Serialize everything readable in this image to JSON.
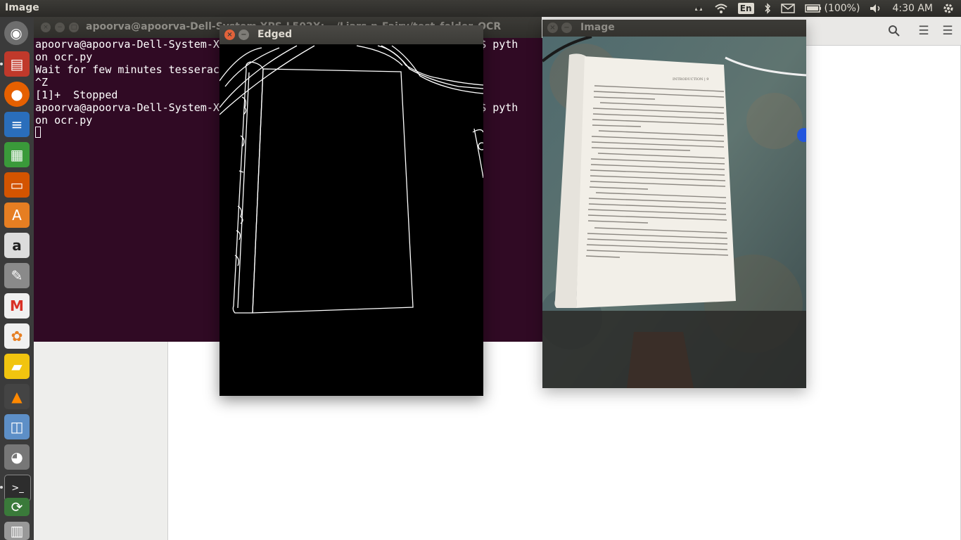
{
  "top_panel": {
    "app_title": "Image",
    "language_indicator": "En",
    "battery_text": "(100%)",
    "time": "4:30 AM",
    "icons": [
      "dropbox-icon",
      "wifi-icon",
      "bluetooth-icon",
      "mail-icon",
      "battery-icon",
      "volume-icon",
      "gear-icon"
    ]
  },
  "launcher": {
    "items": [
      "dash-home",
      "files",
      "firefox",
      "libreoffice-writer",
      "libreoffice-calc",
      "libreoffice-impress",
      "ubuntu-software",
      "amazon",
      "system-settings",
      "gmail",
      "app-icon",
      "folder",
      "vlc",
      "screenshot",
      "gimp",
      "terminal",
      "backup",
      "trash"
    ]
  },
  "background_window": {
    "title": "apoorva@apoorva-Dell-System-XPS-L502X: ~/Liars-n-Fairy/test_folder_OCR"
  },
  "terminal": {
    "lines": [
      "apoorva@apoorva-Dell-System-X                                      OCR$ pyth",
      "on ocr.py",
      "Wait for few minutes tesserac",
      "^Z",
      "[1]+  Stopped",
      "apoorva@apoorva-Dell-System-X                                      OCR$ pyth",
      "on ocr.py"
    ]
  },
  "edged_window": {
    "title": "Edged",
    "close_label": "×",
    "minimize_label": "−"
  },
  "image_window": {
    "title": "Image",
    "close_label": "×",
    "minimize_label": "−"
  },
  "page_photo": {
    "header": "INTRODUCTION | 9",
    "paragraphs": [
      "other salespeople what I was doing that enabled me to sell so much more than anyone else. I accepted his offer and from that day forward, my life was never the same.",
      "Within eighteen months, I had moved from one job to another and then to another. I went from personal selling to becoming a sales manager with people selling for me. I recruited and built a ninety-five-person sales force. I went literally from worrying about my next meal to walking around with a pocket full of $20 bills.",
      "I began teaching my salespeople how to write out their goals and how to sell more effectively. In almost no time at all, they increased their incomes as much as tenfold. Today, many of them are millionaires and multimillionaires.",
      "It's important to note that since those days in my mid-twenties, my life has not been a smooth series of upward steps. It has included many ups and downs, marked by occasional successes and temporary failures. I have traveled, lived, and worked in more than eighty countries, learning French, German, and Spanish along the way and working in twenty-two different fields.",
      "As the result of inexperience and sometimes sheer stupidity, I have spent or lost everything I made and had to start over again—several times. Whenever this happened, I would begin by sitting down with a piece of paper and laying out a new set of goals for myself, using the methods that I'll explain in the pages ahead.",
      "After several years of hit-and-miss goal setting and achieving, I finally decided to collect everything I had learned into a single system. By assembling these ideas and strategies in one place, I developed a goal-setting methodology and process, with a beginning, middle, and end, and began to follow it every day."
    ]
  }
}
